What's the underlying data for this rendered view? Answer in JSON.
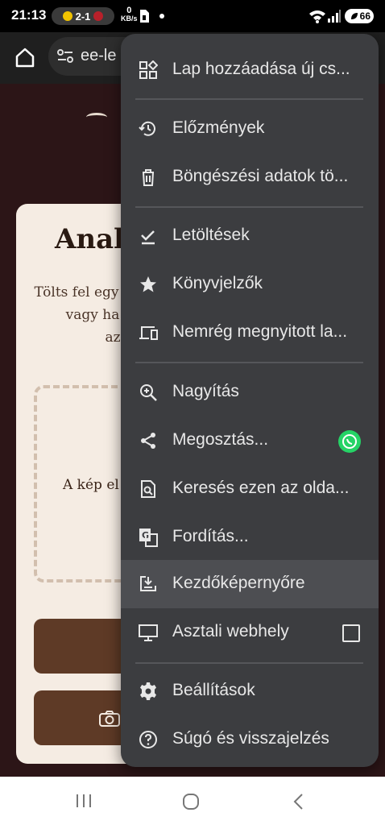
{
  "status": {
    "time": "21:13",
    "score": "2-1",
    "kbs_value": "0",
    "kbs_unit": "KB/s",
    "battery": "66"
  },
  "toolbar": {
    "url_partial": "ee-le"
  },
  "page": {
    "title_partial": "Anal",
    "desc_line1": "Tölts fel egy",
    "desc_line2": "vagy ha",
    "desc_line3": "az",
    "drop_text": "A kép el"
  },
  "menu": {
    "items": [
      {
        "label": "Lap hozzáadása új cs...",
        "icon": "add-to-group-icon"
      },
      {
        "label": "Előzmények",
        "icon": "history-icon"
      },
      {
        "label": "Böngészési adatok tö...",
        "icon": "trash-icon"
      },
      {
        "label": "Letöltések",
        "icon": "download-done-icon"
      },
      {
        "label": "Könyvjelzők",
        "icon": "star-icon"
      },
      {
        "label": "Nemrég megnyitott la...",
        "icon": "devices-icon"
      },
      {
        "label": "Nagyítás",
        "icon": "zoom-icon"
      },
      {
        "label": "Megosztás...",
        "icon": "share-icon"
      },
      {
        "label": "Keresés ezen az olda...",
        "icon": "find-in-page-icon"
      },
      {
        "label": "Fordítás...",
        "icon": "translate-icon"
      },
      {
        "label": "Kezdőképernyőre",
        "icon": "add-to-home-icon"
      },
      {
        "label": "Asztali webhely",
        "icon": "desktop-icon"
      },
      {
        "label": "Beállítások",
        "icon": "settings-icon"
      },
      {
        "label": "Súgó és visszajelzés",
        "icon": "help-icon"
      }
    ]
  },
  "colors": {
    "menu_bg": "#3c3d40",
    "menu_highlight": "#4d4e52",
    "page_bg": "#2c1517",
    "card_bg": "#f5ece3",
    "accent_brown": "#5e3a26",
    "whatsapp": "#25d366"
  }
}
